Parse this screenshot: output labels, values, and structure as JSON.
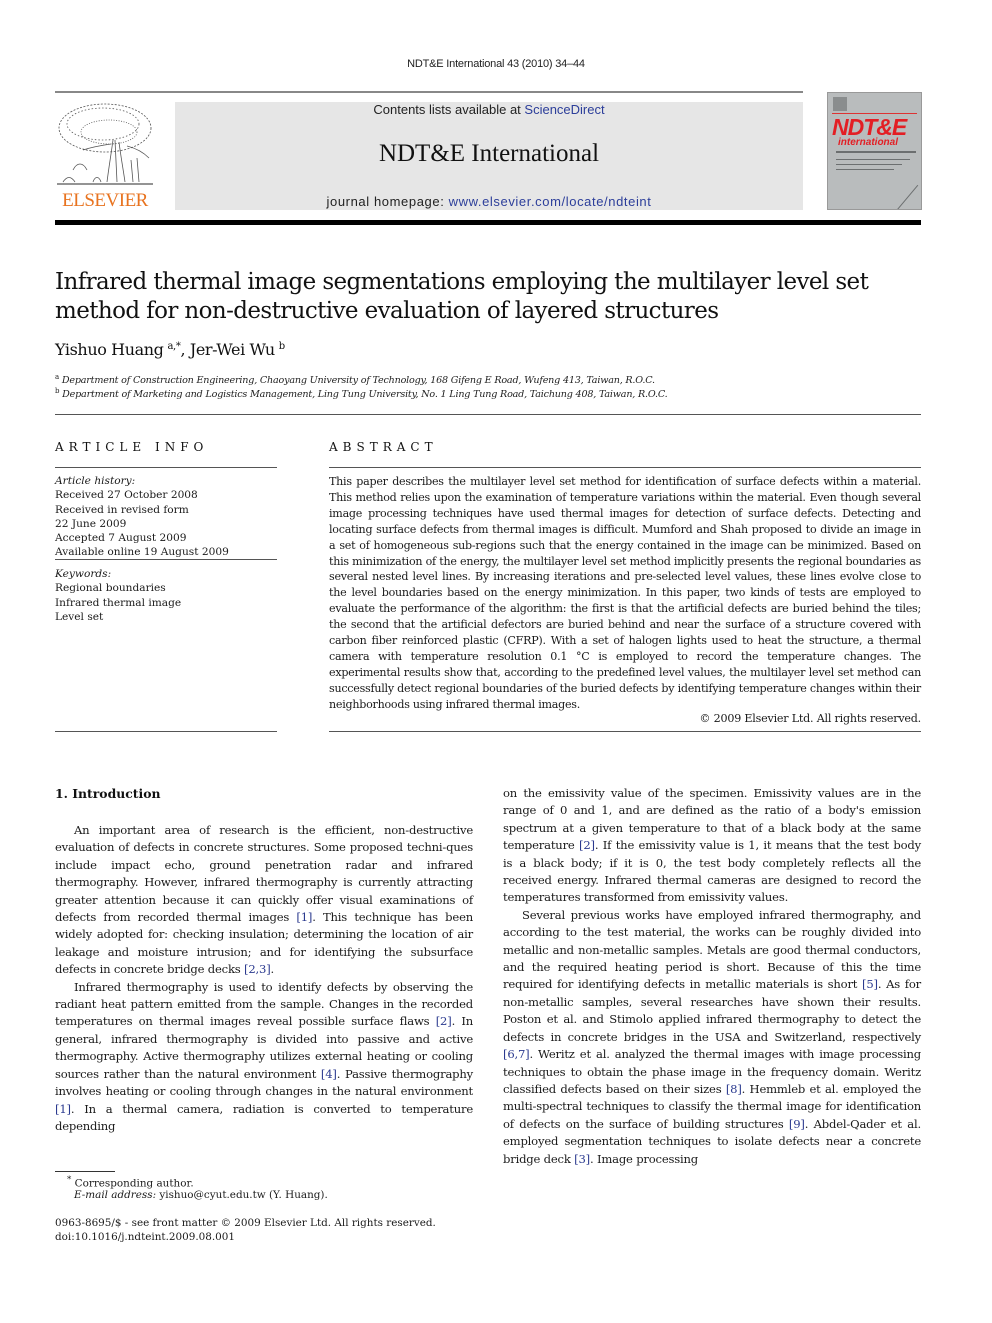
{
  "running_head": "NDT&E International 43 (2010) 34–44",
  "masthead": {
    "publisher_logo_text": "ELSEVIER",
    "contents_prefix": "Contents lists available at ",
    "contents_link": "ScienceDirect",
    "journal_name": "NDT&E International",
    "homepage_prefix": "journal homepage: ",
    "homepage_link": "www.elsevier.com/locate/ndteint",
    "cover": {
      "title": "NDT&E",
      "subtitle": "international",
      "title_color": "#e31e24",
      "background_color": "#b9bcbd"
    },
    "logo_color": "#e8731f",
    "link_color": "#2c3e9a"
  },
  "article": {
    "title": "Infrared thermal image segmentations employing the multilayer level set method for non-destructive evaluation of layered structures",
    "authors": [
      {
        "name": "Yishuo Huang",
        "marks": "a,*"
      },
      {
        "name": "Jer-Wei Wu",
        "marks": "b"
      }
    ],
    "author_separator": ", ",
    "affiliations": [
      {
        "mark": "a",
        "text": "Department of Construction Engineering, Chaoyang University of Technology, 168 Gifeng E Road, Wufeng 413, Taiwan, R.O.C."
      },
      {
        "mark": "b",
        "text": "Department of Marketing and Logistics Management, Ling Tung University, No. 1 Ling Tung Road, Taichung 408, Taiwan, R.O.C."
      }
    ]
  },
  "article_info": {
    "heading": "ARTICLE INFO",
    "history_label": "Article history:",
    "history": [
      "Received 27 October 2008",
      "Received in revised form",
      "22 June 2009",
      "Accepted 7 August 2009",
      "Available online 19 August 2009"
    ],
    "keywords_label": "Keywords:",
    "keywords": [
      "Regional boundaries",
      "Infrared thermal image",
      "Level set"
    ]
  },
  "abstract": {
    "heading": "ABSTRACT",
    "text": "This paper describes the multilayer level set method for identification of surface defects within a material. This method relies upon the examination of temperature variations within the material. Even though several image processing techniques have used thermal images for detection of surface defects. Detecting and locating surface defects from thermal images is difficult. Mumford and Shah proposed to divide an image in a set of homogeneous sub-regions such that the energy contained in the image can be minimized. Based on this minimization of the energy, the multilayer level set method implicitly presents the regional boundaries as several nested level lines. By increasing iterations and pre-selected level values, these lines evolve close to the level boundaries based on the energy minimization. In this paper, two kinds of tests are employed to evaluate the performance of the algorithm: the first is that the artificial defects are buried behind the tiles; the second that the artificial defectors are buried behind and near the surface of a structure covered with carbon fiber reinforced plastic (CFRP). With a set of halogen lights used to heat the structure, a thermal camera with temperature resolution 0.1 °C is employed to record the temperature changes. The experimental results show that, according to the predefined level values, the multilayer level set method can successfully detect regional boundaries of the buried defects by identifying temperature changes within their neighborhoods using infrared thermal images.",
    "copyright": "© 2009 Elsevier Ltd. All rights reserved."
  },
  "body": {
    "section_heading": "1.  Introduction",
    "left_paragraphs": [
      [
        {
          "t": "An important area of research is the efficient, non-destructive evaluation of defects in concrete structures. Some proposed techni-ques include impact echo, ground penetration radar and infrared thermography. However, infrared thermography is currently attracting greater attention because it can quickly offer visual examinations of defects from recorded thermal images "
        },
        {
          "cite": "[1]"
        },
        {
          "t": ". This technique has been widely adopted for: checking insulation; determining the location of air leakage and moisture intrusion; and for identifying the subsurface defects in concrete bridge decks "
        },
        {
          "cite": "[2,3]"
        },
        {
          "t": "."
        }
      ],
      [
        {
          "t": "Infrared thermography is used to identify defects by observing the radiant heat pattern emitted from the sample. Changes in the recorded temperatures on thermal images reveal possible surface flaws "
        },
        {
          "cite": "[2]"
        },
        {
          "t": ". In general, infrared thermography is divided into passive and active thermography. Active thermography utilizes external heating or cooling sources rather than the natural environment "
        },
        {
          "cite": "[4]"
        },
        {
          "t": ". Passive thermography involves heating or cooling through changes in the natural environment "
        },
        {
          "cite": "[1]"
        },
        {
          "t": ". In a thermal camera, radiation is converted to temperature depending"
        }
      ]
    ],
    "right_paragraphs": [
      [
        {
          "t": "on the emissivity value of the specimen. Emissivity values are in the range of 0 and 1, and are defined as the ratio of a body's emission spectrum at a given temperature to that of a black body at the same temperature "
        },
        {
          "cite": "[2]"
        },
        {
          "t": ". If the emissivity value is 1, it means that the test body is a black body; if it is 0, the test body completely reflects all the received energy. Infrared thermal cameras are designed to record the temperatures transformed from emissivity values."
        }
      ],
      [
        {
          "t": "Several previous works have employed infrared thermography, and according to the test material, the works can be roughly divided into metallic and non-metallic samples. Metals are good thermal conductors, and the required heating period is short. Because of this the time required for identifying defects in metallic materials is short "
        },
        {
          "cite": "[5]"
        },
        {
          "t": ". As for non-metallic samples, several researches have shown their results. Poston et al. and Stimolo applied infrared thermography to detect the defects in concrete bridges in the USA and Switzerland, respectively "
        },
        {
          "cite": "[6,7]"
        },
        {
          "t": ". Weritz et al. analyzed the thermal images with image processing techniques to obtain the phase image in the frequency domain. Weritz classified defects based on their sizes "
        },
        {
          "cite": "[8]"
        },
        {
          "t": ". Hemmleb et al. employed the multi-spectral techniques to classify the thermal image for identification of defects on the surface of building structures "
        },
        {
          "cite": "[9]"
        },
        {
          "t": ". Abdel-Qader et al. employed segmentation techniques to isolate defects near a concrete bridge deck "
        },
        {
          "cite": "[3]"
        },
        {
          "t": ". Image processing"
        }
      ]
    ]
  },
  "footnotes": {
    "corresponding_mark": "*",
    "corresponding_text": "Corresponding author.",
    "email_label": "E-mail address:",
    "email_value": " yishuo@cyut.edu.tw (Y. Huang).",
    "issn_line": "0963-8695/$ - see front matter © 2009 Elsevier Ltd. All rights reserved.",
    "doi_line": "doi:10.1016/j.ndteint.2009.08.001"
  }
}
